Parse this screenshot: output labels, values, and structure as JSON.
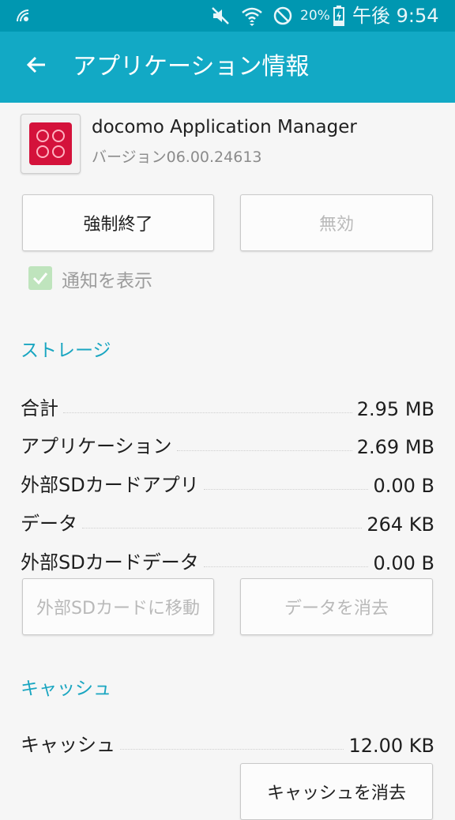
{
  "status_bar": {
    "battery": "20%",
    "time": "午後 9:54",
    "icons": [
      "signal-wave-icon",
      "mute-icon",
      "wifi-icon",
      "blocked-icon",
      "battery-charging-icon"
    ]
  },
  "app_bar": {
    "title": "アプリケーション情報",
    "back_icon": "back-arrow-icon"
  },
  "app": {
    "name": "docomo Application Manager",
    "version": "バージョン06.00.24613",
    "icon": "docomo-app-icon",
    "icon_color": "#d4123b"
  },
  "actions": {
    "force_stop": "強制終了",
    "disable": "無効"
  },
  "notification": {
    "label": "通知を表示",
    "checked": true
  },
  "storage": {
    "title": "ストレージ",
    "rows": [
      {
        "label": "合計",
        "value": "2.95 MB"
      },
      {
        "label": "アプリケーション",
        "value": "2.69 MB"
      },
      {
        "label": "外部SDカードアプリ",
        "value": "0.00 B"
      },
      {
        "label": "データ",
        "value": "264 KB"
      },
      {
        "label": "外部SDカードデータ",
        "value": "0.00 B"
      }
    ],
    "move_to_sd": "外部SDカードに移動",
    "clear_data": "データを消去"
  },
  "cache": {
    "title": "キャッシュ",
    "label": "キャッシュ",
    "value": "12.00 KB",
    "clear_cache": "キャッシュを消去"
  },
  "colors": {
    "status_bar": "#0097b1",
    "app_bar": "#12a9c5",
    "section_title": "#1aa6c1",
    "checkbox": "#bfe4bd"
  }
}
